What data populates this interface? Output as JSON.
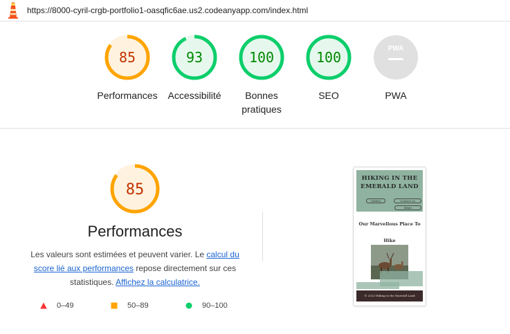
{
  "topbar": {
    "url": "https://8000-cyril-crgb-portfolio1-oasqfic6ae.us2.codeanyapp.com/index.html",
    "logo_icon": "lighthouse-icon"
  },
  "gauges": [
    {
      "id": "performance",
      "score": "85",
      "value": 85,
      "label_lines": [
        "Performances"
      ],
      "color": "#ffa400",
      "fill": "#fff3e0",
      "text_color": "#c33300"
    },
    {
      "id": "accessibility",
      "score": "93",
      "value": 93,
      "label_lines": [
        "Accessibilité"
      ],
      "color": "#0cce6b",
      "fill": "#e6f8ee",
      "text_color": "#008800"
    },
    {
      "id": "best-practices",
      "score": "100",
      "value": 100,
      "label_lines": [
        "Bonnes",
        "pratiques"
      ],
      "color": "#0cce6b",
      "fill": "#e6f8ee",
      "text_color": "#008800"
    },
    {
      "id": "seo",
      "score": "100",
      "value": 100,
      "label_lines": [
        "SEO"
      ],
      "color": "#0cce6b",
      "fill": "#e6f8ee",
      "text_color": "#008800"
    },
    {
      "id": "pwa",
      "score": "PWA",
      "label_lines": [
        "PWA"
      ],
      "color": "#e0e0e0",
      "fill": "#e0e0e0",
      "text_color": "#ffffff",
      "icon": "pwa-icon"
    }
  ],
  "performance": {
    "score": "85",
    "value": 85,
    "title": "Performances",
    "desc_before": "Les valeurs sont estimées et peuvent varier. Le ",
    "link1": "calcul du score lié aux performances",
    "desc_middle": " repose directement sur ces statistiques. ",
    "link2": "Affichez la calculatrice."
  },
  "legend": [
    {
      "range": "0–49",
      "icon": "triangle-fail-icon",
      "color": "#ff3333"
    },
    {
      "range": "50–89",
      "icon": "square-average-icon",
      "color": "#ffa400"
    },
    {
      "range": "90–100",
      "icon": "circle-pass-icon",
      "color": "#0cce6b"
    }
  ],
  "screenshot": {
    "site_title": "HIKING IN THE EMERALD LAND",
    "nav": [
      "Gallery",
      "Contact us",
      "Hikes"
    ],
    "tagline": "Our Marvellous Place To Hike",
    "footer": "© 2023 Hiking in the Emerald Land"
  }
}
